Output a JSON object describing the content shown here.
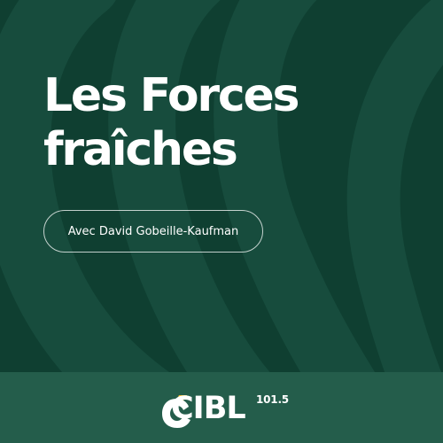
{
  "title_lines": [
    "Les Forces",
    "fraîches"
  ],
  "host_label": "Avec David Gobeille-Kaufman",
  "logo": {
    "wordmark": "CIBL",
    "frequency": "101.5"
  },
  "colors": {
    "background": "#0f3f31",
    "footer": "#245d4b",
    "pattern": "#174c3d",
    "logo_accent": "#f0b51f",
    "text": "#ffffff"
  }
}
